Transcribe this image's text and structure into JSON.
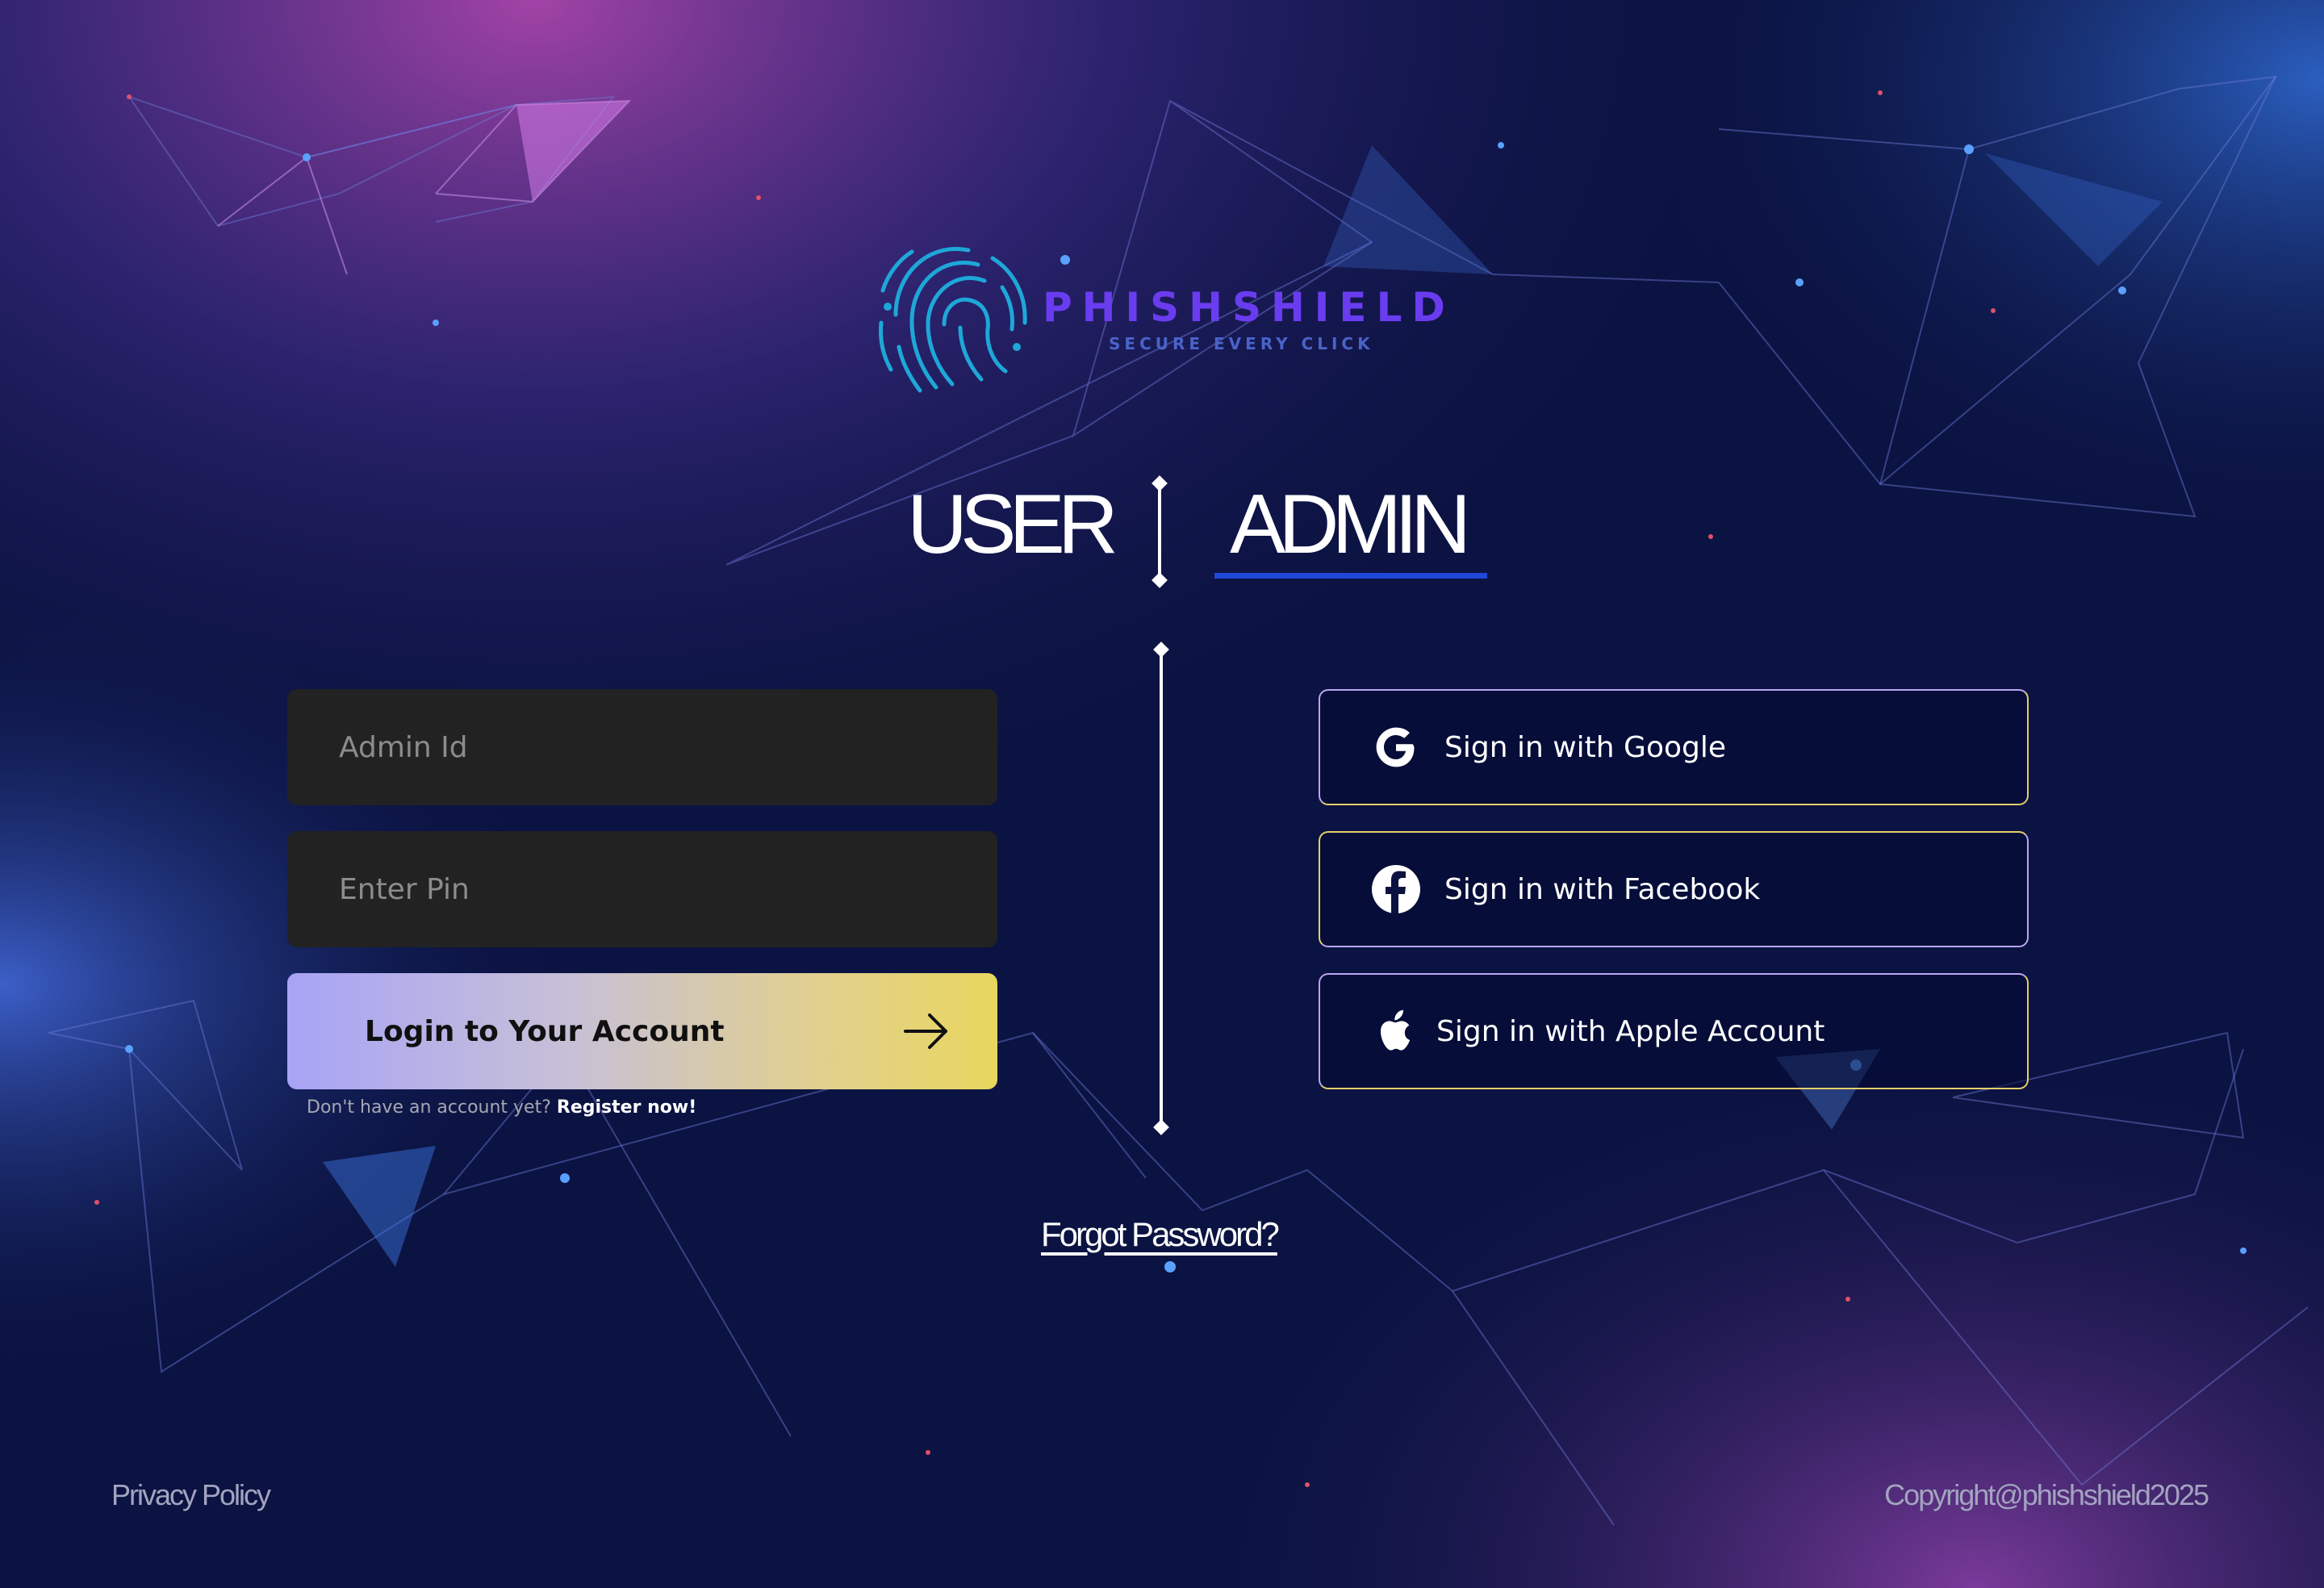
{
  "brand": {
    "name": "PHISHSHIELD",
    "tagline": "SECURE EVERY CLICK"
  },
  "tabs": [
    {
      "label": "USER",
      "selected": false
    },
    {
      "label": "ADMIN",
      "selected": true
    }
  ],
  "form": {
    "admin_id": {
      "placeholder": "Admin Id",
      "value": ""
    },
    "pin": {
      "placeholder": "Enter Pin",
      "value": ""
    },
    "login_label": "Login to Your Account",
    "register_prompt": "Don't have an account yet?",
    "register_link": "Register now!"
  },
  "social": [
    {
      "label": "Sign in with Google",
      "icon": "google-icon"
    },
    {
      "label": "Sign in with Facebook",
      "icon": "facebook-icon"
    },
    {
      "label": "Sign in with Apple Account",
      "icon": "apple-icon"
    }
  ],
  "forgot_password": "Forgot Password?",
  "footer": {
    "privacy": "Privacy Policy",
    "copyright": "Copyright@phishshield2025"
  },
  "colors": {
    "background_top_left": "#9a3fa0",
    "background_main": "#0b1240",
    "brand_purple": "#6a3cf0",
    "tab_underline": "#1f47d8",
    "input_bg": "#222222",
    "login_gradient_start": "#a8a4f6",
    "login_gradient_end": "#e8d65e",
    "social_border_purple": "#b9a6f2",
    "social_border_yellow": "#e2cf6a"
  }
}
